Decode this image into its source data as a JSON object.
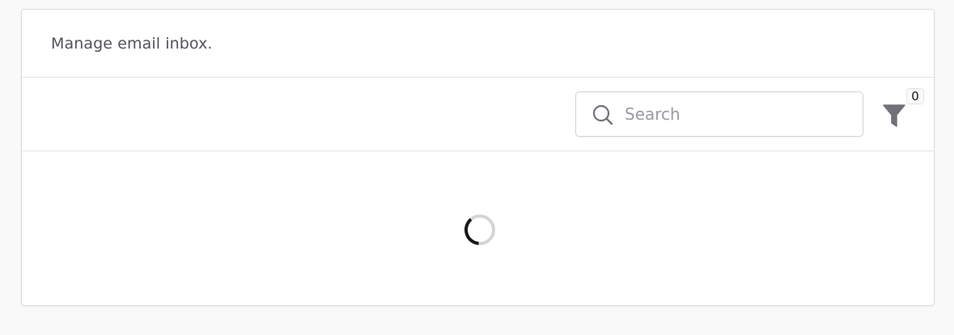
{
  "header": {
    "description": "Manage email inbox."
  },
  "toolbar": {
    "search": {
      "placeholder": "Search",
      "value": "",
      "icon": "search-icon"
    },
    "filter": {
      "icon": "filter-icon",
      "active_count": "0"
    }
  },
  "content": {
    "state": "loading",
    "spinner_icon": "loading-spinner-icon"
  },
  "colors": {
    "page_background": "#f9f9f9",
    "card_background": "#ffffff",
    "border": "#e4e4e7",
    "icon_gray": "#71717a",
    "spinner_track": "#d4d4d8",
    "spinner_arc": "#18181b"
  }
}
